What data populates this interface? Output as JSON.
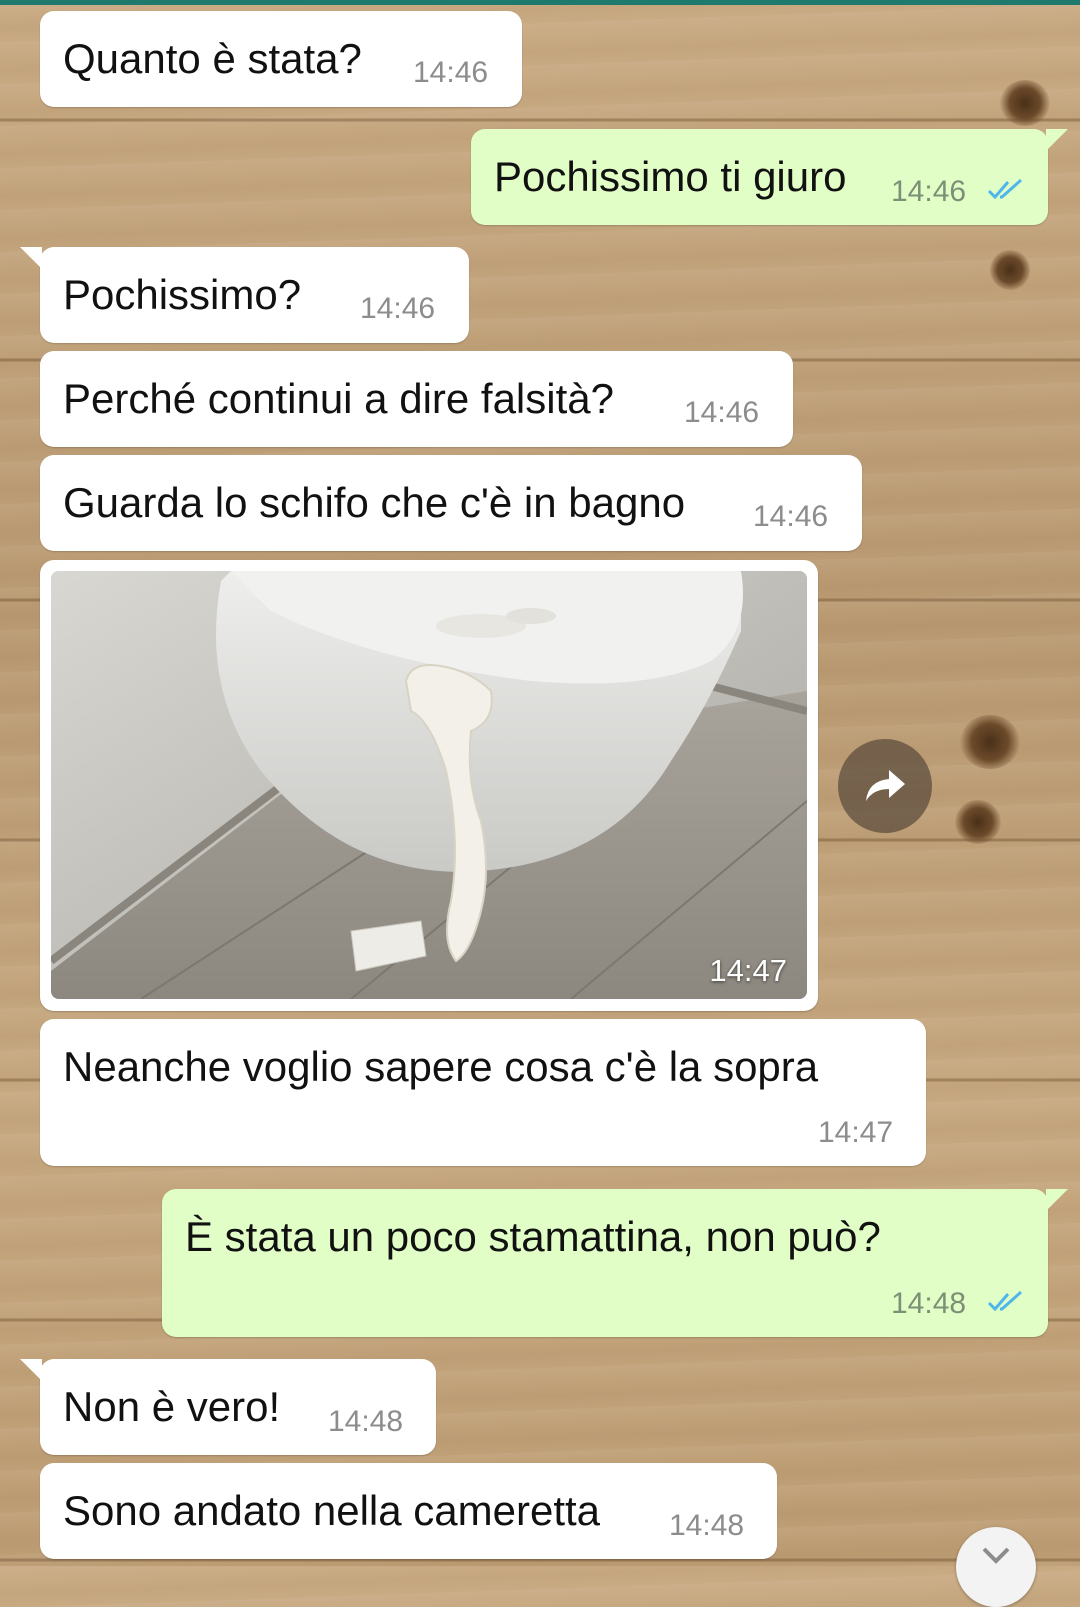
{
  "messages": [
    {
      "text": "Quanto è stata?",
      "time": "14:46"
    },
    {
      "text": "Pochissimo ti giuro",
      "time": "14:46"
    },
    {
      "text": "Pochissimo?",
      "time": "14:46"
    },
    {
      "text": "Perché continui a dire falsità?",
      "time": "14:46"
    },
    {
      "text": "Guarda lo schifo che c'è in bagno",
      "time": "14:46"
    },
    {
      "text": "",
      "time": "14:47"
    },
    {
      "text": "Neanche voglio sapere cosa c'è la sopra",
      "time": "14:47"
    },
    {
      "text": "È stata un poco stamattina, non può?",
      "time": "14:48"
    },
    {
      "text": "Non è vero!",
      "time": "14:48"
    },
    {
      "text": "Sono andato nella cameretta",
      "time": "14:48"
    }
  ],
  "icons": {
    "read_receipt": "double-check-icon",
    "forward": "forward-arrow-icon",
    "scroll": "chevron-down-icon"
  },
  "colors": {
    "incoming_bubble": "#ffffff",
    "outgoing_bubble": "#e1fec6",
    "read_tick": "#4fb6ec",
    "top_bar": "#1d7a6c"
  }
}
